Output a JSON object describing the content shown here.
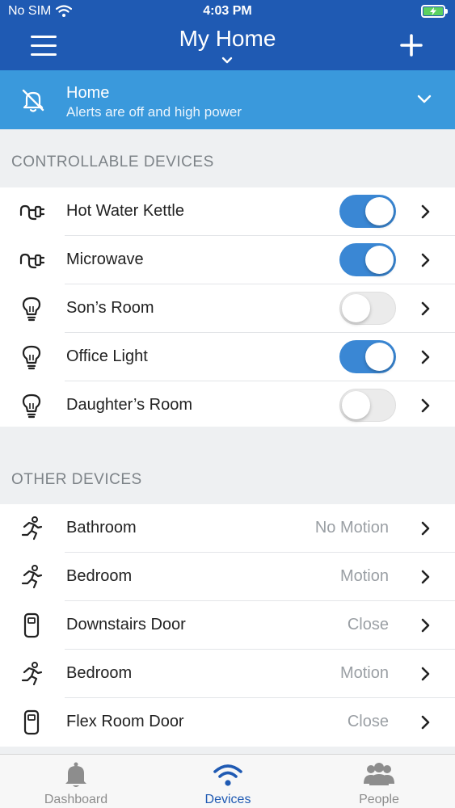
{
  "status_bar": {
    "carrier": "No SIM",
    "time": "4:03 PM"
  },
  "nav": {
    "title": "My Home"
  },
  "alert": {
    "location": "Home",
    "subtitle": "Alerts are off and high power"
  },
  "sections": {
    "controllable": "CONTROLLABLE DEVICES",
    "other": "OTHER DEVICES"
  },
  "controllable_devices": [
    {
      "label": "Hot Water Kettle",
      "icon": "plug-icon",
      "on": true
    },
    {
      "label": "Microwave",
      "icon": "plug-icon",
      "on": true
    },
    {
      "label": "Son’s Room",
      "icon": "lightbulb-icon",
      "on": false
    },
    {
      "label": "Office Light",
      "icon": "lightbulb-icon",
      "on": true
    },
    {
      "label": "Daughter’s Room",
      "icon": "lightbulb-icon",
      "on": false
    }
  ],
  "other_devices": [
    {
      "label": "Bathroom",
      "icon": "motion-icon",
      "value": "No Motion"
    },
    {
      "label": "Bedroom",
      "icon": "motion-icon",
      "value": "Motion"
    },
    {
      "label": "Downstairs Door",
      "icon": "door-sensor-icon",
      "value": "Close"
    },
    {
      "label": "Bedroom",
      "icon": "motion-icon",
      "value": "Motion"
    },
    {
      "label": "Flex Room Door",
      "icon": "door-sensor-icon",
      "value": "Close"
    }
  ],
  "tabs": [
    {
      "label": "Dashboard",
      "icon": "bell-icon",
      "active": false
    },
    {
      "label": "Devices",
      "icon": "wifi-icon",
      "active": true
    },
    {
      "label": "People",
      "icon": "people-icon",
      "active": false
    }
  ],
  "colors": {
    "brand": "#1f5ab3",
    "alert_bar": "#3a99dc",
    "toggle_on": "#3a87d4",
    "battery": "#5cd160"
  }
}
